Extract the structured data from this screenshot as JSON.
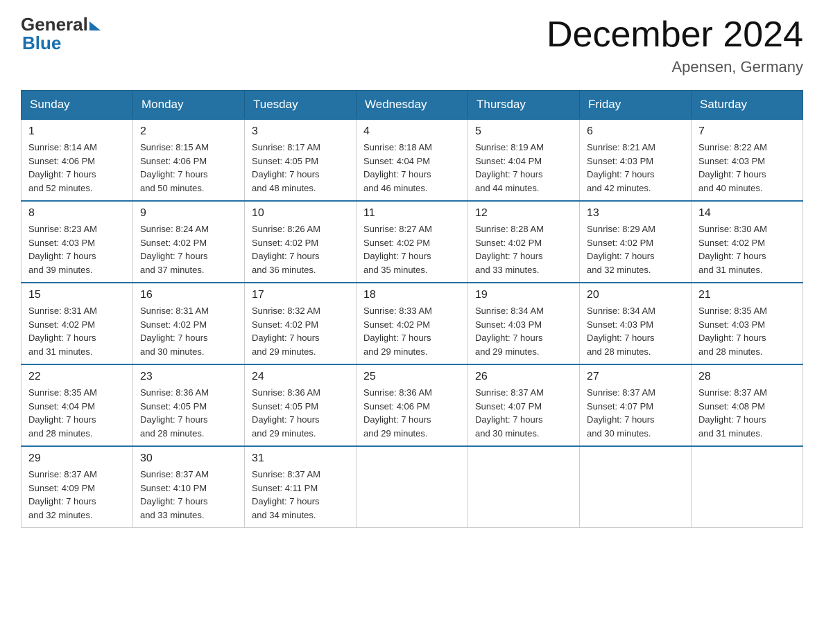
{
  "logo": {
    "general": "General",
    "blue": "Blue",
    "arrow": "▶"
  },
  "title": "December 2024",
  "subtitle": "Apensen, Germany",
  "days_of_week": [
    "Sunday",
    "Monday",
    "Tuesday",
    "Wednesday",
    "Thursday",
    "Friday",
    "Saturday"
  ],
  "weeks": [
    [
      {
        "day": "1",
        "sunrise": "8:14 AM",
        "sunset": "4:06 PM",
        "daylight": "7 hours and 52 minutes."
      },
      {
        "day": "2",
        "sunrise": "8:15 AM",
        "sunset": "4:06 PM",
        "daylight": "7 hours and 50 minutes."
      },
      {
        "day": "3",
        "sunrise": "8:17 AM",
        "sunset": "4:05 PM",
        "daylight": "7 hours and 48 minutes."
      },
      {
        "day": "4",
        "sunrise": "8:18 AM",
        "sunset": "4:04 PM",
        "daylight": "7 hours and 46 minutes."
      },
      {
        "day": "5",
        "sunrise": "8:19 AM",
        "sunset": "4:04 PM",
        "daylight": "7 hours and 44 minutes."
      },
      {
        "day": "6",
        "sunrise": "8:21 AM",
        "sunset": "4:03 PM",
        "daylight": "7 hours and 42 minutes."
      },
      {
        "day": "7",
        "sunrise": "8:22 AM",
        "sunset": "4:03 PM",
        "daylight": "7 hours and 40 minutes."
      }
    ],
    [
      {
        "day": "8",
        "sunrise": "8:23 AM",
        "sunset": "4:03 PM",
        "daylight": "7 hours and 39 minutes."
      },
      {
        "day": "9",
        "sunrise": "8:24 AM",
        "sunset": "4:02 PM",
        "daylight": "7 hours and 37 minutes."
      },
      {
        "day": "10",
        "sunrise": "8:26 AM",
        "sunset": "4:02 PM",
        "daylight": "7 hours and 36 minutes."
      },
      {
        "day": "11",
        "sunrise": "8:27 AM",
        "sunset": "4:02 PM",
        "daylight": "7 hours and 35 minutes."
      },
      {
        "day": "12",
        "sunrise": "8:28 AM",
        "sunset": "4:02 PM",
        "daylight": "7 hours and 33 minutes."
      },
      {
        "day": "13",
        "sunrise": "8:29 AM",
        "sunset": "4:02 PM",
        "daylight": "7 hours and 32 minutes."
      },
      {
        "day": "14",
        "sunrise": "8:30 AM",
        "sunset": "4:02 PM",
        "daylight": "7 hours and 31 minutes."
      }
    ],
    [
      {
        "day": "15",
        "sunrise": "8:31 AM",
        "sunset": "4:02 PM",
        "daylight": "7 hours and 31 minutes."
      },
      {
        "day": "16",
        "sunrise": "8:31 AM",
        "sunset": "4:02 PM",
        "daylight": "7 hours and 30 minutes."
      },
      {
        "day": "17",
        "sunrise": "8:32 AM",
        "sunset": "4:02 PM",
        "daylight": "7 hours and 29 minutes."
      },
      {
        "day": "18",
        "sunrise": "8:33 AM",
        "sunset": "4:02 PM",
        "daylight": "7 hours and 29 minutes."
      },
      {
        "day": "19",
        "sunrise": "8:34 AM",
        "sunset": "4:03 PM",
        "daylight": "7 hours and 29 minutes."
      },
      {
        "day": "20",
        "sunrise": "8:34 AM",
        "sunset": "4:03 PM",
        "daylight": "7 hours and 28 minutes."
      },
      {
        "day": "21",
        "sunrise": "8:35 AM",
        "sunset": "4:03 PM",
        "daylight": "7 hours and 28 minutes."
      }
    ],
    [
      {
        "day": "22",
        "sunrise": "8:35 AM",
        "sunset": "4:04 PM",
        "daylight": "7 hours and 28 minutes."
      },
      {
        "day": "23",
        "sunrise": "8:36 AM",
        "sunset": "4:05 PM",
        "daylight": "7 hours and 28 minutes."
      },
      {
        "day": "24",
        "sunrise": "8:36 AM",
        "sunset": "4:05 PM",
        "daylight": "7 hours and 29 minutes."
      },
      {
        "day": "25",
        "sunrise": "8:36 AM",
        "sunset": "4:06 PM",
        "daylight": "7 hours and 29 minutes."
      },
      {
        "day": "26",
        "sunrise": "8:37 AM",
        "sunset": "4:07 PM",
        "daylight": "7 hours and 30 minutes."
      },
      {
        "day": "27",
        "sunrise": "8:37 AM",
        "sunset": "4:07 PM",
        "daylight": "7 hours and 30 minutes."
      },
      {
        "day": "28",
        "sunrise": "8:37 AM",
        "sunset": "4:08 PM",
        "daylight": "7 hours and 31 minutes."
      }
    ],
    [
      {
        "day": "29",
        "sunrise": "8:37 AM",
        "sunset": "4:09 PM",
        "daylight": "7 hours and 32 minutes."
      },
      {
        "day": "30",
        "sunrise": "8:37 AM",
        "sunset": "4:10 PM",
        "daylight": "7 hours and 33 minutes."
      },
      {
        "day": "31",
        "sunrise": "8:37 AM",
        "sunset": "4:11 PM",
        "daylight": "7 hours and 34 minutes."
      },
      null,
      null,
      null,
      null
    ]
  ],
  "labels": {
    "sunrise": "Sunrise:",
    "sunset": "Sunset:",
    "daylight": "Daylight:"
  }
}
